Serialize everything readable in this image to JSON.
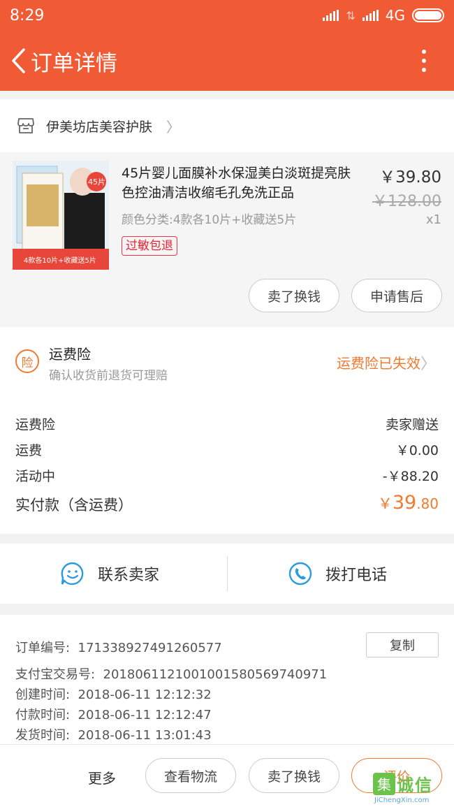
{
  "status_bar": {
    "time": "8:29",
    "network": "4G"
  },
  "header": {
    "title": "订单详情"
  },
  "shop": {
    "name": "伊美坊店美容护肤"
  },
  "product": {
    "title": "45片婴儿面膜补水保湿美白淡斑提亮肤色控油清洁收缩毛孔免洗正品",
    "sku": "颜色分类:4款各10片+收藏送5片",
    "tag": "过敏包退",
    "price": "￥39.80",
    "original_price": "￥128.00",
    "quantity": "x1",
    "thumb_badge": "45片",
    "thumb_caption": "4款各10片+收藏送5片",
    "buttons": {
      "sell": "卖了换钱",
      "after_sale": "申请售后"
    }
  },
  "insurance": {
    "icon_char": "险",
    "title": "运费险",
    "subtitle": "确认收货前退货可理赔",
    "status": "运费险已失效",
    "status_color": "#f07a30"
  },
  "costs": [
    {
      "label": "运费险",
      "value": "卖家赠送"
    },
    {
      "label": "运费",
      "value": "￥0.00"
    },
    {
      "label": "活动中",
      "value": "-￥88.20"
    }
  ],
  "total": {
    "label": "实付款（含运费）",
    "symbol": "￥",
    "integer": "39",
    "decimal": ".80"
  },
  "contact": {
    "seller": "联系卖家",
    "call": "拨打电话"
  },
  "order_info": {
    "copy_label": "复制",
    "lines": [
      {
        "label": "订单编号:",
        "value": "171338927491260577"
      },
      {
        "label": "支付宝交易号:",
        "value": "2018061121001001580569740971"
      },
      {
        "label": "创建时间:",
        "value": "2018-06-11 12:12:32"
      },
      {
        "label": "付款时间:",
        "value": "2018-06-11 12:12:47"
      },
      {
        "label": "发货时间:",
        "value": "2018-06-11 13:01:43"
      }
    ]
  },
  "bottom_bar": {
    "more": "更多",
    "logistics": "查看物流",
    "sell": "卖了换钱",
    "review": "评价"
  },
  "watermark": {
    "logo_char": "集",
    "text": "诚信",
    "url": "JiChengXin.com"
  },
  "colors": {
    "brand": "#f05a34",
    "accent": "#f07a30"
  }
}
